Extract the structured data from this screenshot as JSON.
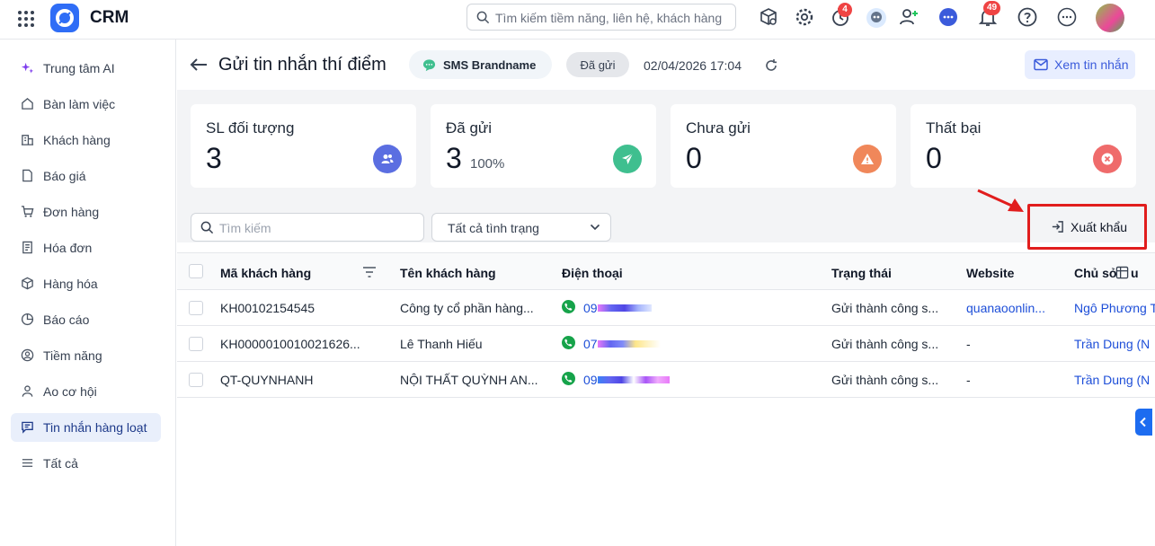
{
  "app": {
    "name": "CRM"
  },
  "search": {
    "placeholder": "Tìm kiếm tiềm năng, liên hệ, khách hàng"
  },
  "topbar": {
    "timer_badge": "4",
    "notification_badge": "49"
  },
  "sidebar": {
    "items": [
      {
        "label": "Trung tâm AI",
        "icon": "sparkle-icon"
      },
      {
        "label": "Bàn làm việc",
        "icon": "home-icon"
      },
      {
        "label": "Khách hàng",
        "icon": "building-icon"
      },
      {
        "label": "Báo giá",
        "icon": "document-icon"
      },
      {
        "label": "Đơn hàng",
        "icon": "cart-icon"
      },
      {
        "label": "Hóa đơn",
        "icon": "receipt-icon"
      },
      {
        "label": "Hàng hóa",
        "icon": "box-icon"
      },
      {
        "label": "Báo cáo",
        "icon": "chart-icon"
      },
      {
        "label": "Tiềm năng",
        "icon": "person-icon"
      },
      {
        "label": "Ao cơ hội",
        "icon": "people-icon"
      },
      {
        "label": "Tin nhắn hàng loạt",
        "icon": "message-icon",
        "active": true
      },
      {
        "label": "Tất cả",
        "icon": "menu-icon"
      }
    ]
  },
  "header": {
    "title": "Gửi tin nhắn thí điểm",
    "channel": "SMS Brandname",
    "status": "Đã gửi",
    "datetime": "02/04/2026 17:04",
    "view_button": "Xem tin nhắn"
  },
  "stats": [
    {
      "label": "SL đối tượng",
      "value": "3",
      "percent": "",
      "color": "#5b6ee1"
    },
    {
      "label": "Đã gửi",
      "value": "3",
      "percent": "100%",
      "color": "#3fbf8f"
    },
    {
      "label": "Chưa gửi",
      "value": "0",
      "percent": "",
      "color": "#f0875a"
    },
    {
      "label": "Thất bại",
      "value": "0",
      "percent": "",
      "color": "#ef6b6b"
    }
  ],
  "filters": {
    "search_placeholder": "Tìm kiếm",
    "status_select": "Tất cả tình trạng",
    "export_button": "Xuất khẩu"
  },
  "table": {
    "columns": [
      "Mã khách hàng",
      "Tên khách hàng",
      "Điện thoại",
      "Trạng thái",
      "Website",
      "Chủ sở hữu"
    ],
    "rows": [
      {
        "code": "KH00102154545",
        "name": "Công ty cổ phần hàng...",
        "phone": "09",
        "status": "Gửi thành công s...",
        "website": "quanaoonlin...",
        "owner": "Ngô Phương T"
      },
      {
        "code": "KH0000010010021626...",
        "name": "Lê Thanh Hiếu",
        "phone": "07",
        "status": "Gửi thành công s...",
        "website": "-",
        "owner": "Trần Dung (N"
      },
      {
        "code": "QT-QUYNHANH",
        "name": "NỘI THẤT QUỲNH AN...",
        "phone": "09",
        "status": "Gửi thành công s...",
        "website": "-",
        "owner": "Trần Dung (N"
      }
    ]
  }
}
